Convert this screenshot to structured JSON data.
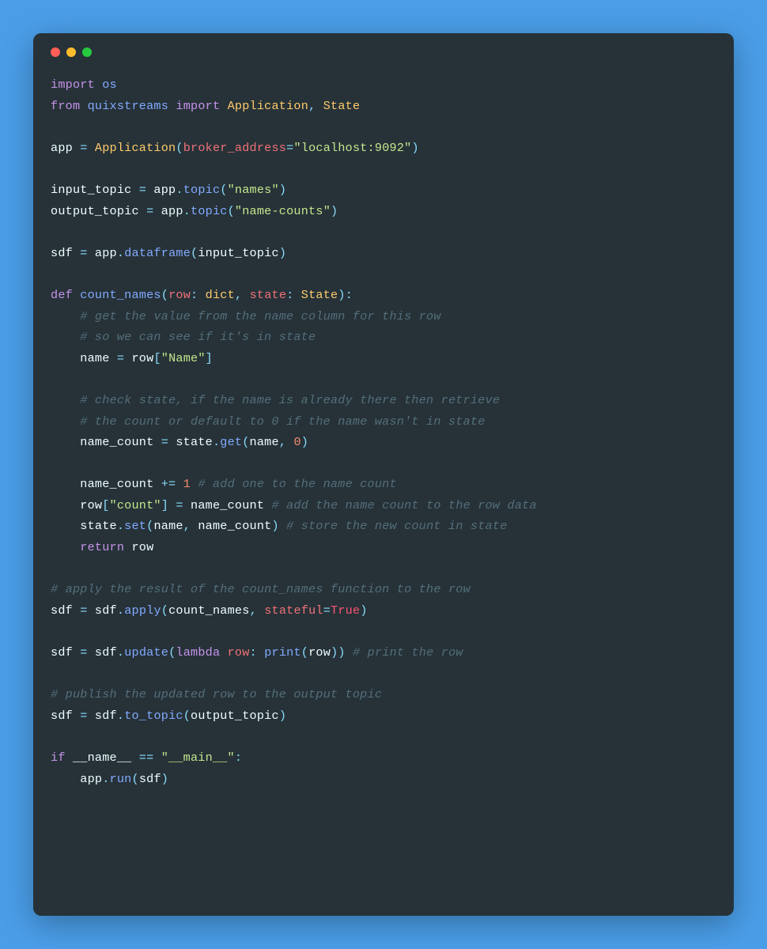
{
  "code": {
    "l1_import": "import",
    "l1_os": "os",
    "l2_from": "from",
    "l2_quixstreams": "quixstreams",
    "l2_import": "import",
    "l2_app": "Application",
    "l2_comma": ", ",
    "l2_state": "State",
    "l4_app": "app",
    "l4_eq": " = ",
    "l4_Application": "Application",
    "l4_lp": "(",
    "l4_broker": "broker_address",
    "l4_assign": "=",
    "l4_addr": "\"localhost:9092\"",
    "l4_rp": ")",
    "l6_it": "input_topic",
    "l6_eq": " = ",
    "l6_app": "app",
    "l6_dot": ".",
    "l6_topic": "topic",
    "l6_lp": "(",
    "l6_names": "\"names\"",
    "l6_rp": ")",
    "l7_ot": "output_topic",
    "l7_eq": " = ",
    "l7_app": "app",
    "l7_dot": ".",
    "l7_topic": "topic",
    "l7_lp": "(",
    "l7_nc": "\"name-counts\"",
    "l7_rp": ")",
    "l9_sdf": "sdf",
    "l9_eq": " = ",
    "l9_app": "app",
    "l9_dot": ".",
    "l9_df": "dataframe",
    "l9_lp": "(",
    "l9_it": "input_topic",
    "l9_rp": ")",
    "l11_def": "def",
    "l11_cn": "count_names",
    "l11_lp": "(",
    "l11_row": "row",
    "l11_colon1": ": ",
    "l11_dict": "dict",
    "l11_comma": ", ",
    "l11_state": "state",
    "l11_colon2": ": ",
    "l11_State": "State",
    "l11_rp": ")",
    "l11_end": ":",
    "l12_c": "# get the value from the name column for this row",
    "l13_c": "# so we can see if it's in state",
    "l14_name": "name",
    "l14_eq": " = ",
    "l14_row": "row",
    "l14_lb": "[",
    "l14_Name": "\"Name\"",
    "l14_rb": "]",
    "l16_c": "# check state, if the name is already there then retrieve",
    "l17_c": "# the count or default to 0 if the name wasn't in state",
    "l18_nc": "name_count",
    "l18_eq": " = ",
    "l18_state": "state",
    "l18_dot": ".",
    "l18_get": "get",
    "l18_lp": "(",
    "l18_name": "name",
    "l18_comma": ", ",
    "l18_zero": "0",
    "l18_rp": ")",
    "l20_nc": "name_count",
    "l20_pe": " += ",
    "l20_one": "1",
    "l20_c": " # add one to the name count",
    "l21_row": "row",
    "l21_lb": "[",
    "l21_count": "\"count\"",
    "l21_rb": "]",
    "l21_eq": " = ",
    "l21_nc": "name_count",
    "l21_c": " # add the name count to the row data",
    "l22_state": "state",
    "l22_dot": ".",
    "l22_set": "set",
    "l22_lp": "(",
    "l22_name": "name",
    "l22_comma": ", ",
    "l22_nc": "name_count",
    "l22_rp": ")",
    "l22_c": " # store the new count in state",
    "l23_return": "return",
    "l23_row": " row",
    "l25_c": "# apply the result of the count_names function to the row",
    "l26_sdf": "sdf",
    "l26_eq": " = ",
    "l26_sdf2": "sdf",
    "l26_dot": ".",
    "l26_apply": "apply",
    "l26_lp": "(",
    "l26_cn": "count_names",
    "l26_comma": ", ",
    "l26_stateful": "stateful",
    "l26_assign": "=",
    "l26_true": "True",
    "l26_rp": ")",
    "l28_sdf": "sdf",
    "l28_eq": " = ",
    "l28_sdf2": "sdf",
    "l28_dot": ".",
    "l28_update": "update",
    "l28_lp": "(",
    "l28_lambda": "lambda",
    "l28_row": " row",
    "l28_colon": ": ",
    "l28_print": "print",
    "l28_lp2": "(",
    "l28_row2": "row",
    "l28_rp2": ")",
    "l28_rp": ")",
    "l28_c": " # print the row",
    "l30_c": "# publish the updated row to the output topic",
    "l31_sdf": "sdf",
    "l31_eq": " = ",
    "l31_sdf2": "sdf",
    "l31_dot": ".",
    "l31_tt": "to_topic",
    "l31_lp": "(",
    "l31_ot": "output_topic",
    "l31_rp": ")",
    "l33_if": "if",
    "l33_name": " __name__",
    "l33_eq": " == ",
    "l33_main": "\"__main__\"",
    "l33_colon": ":",
    "l34_app": "app",
    "l34_dot": ".",
    "l34_run": "run",
    "l34_lp": "(",
    "l34_sdf": "sdf",
    "l34_rp": ")"
  }
}
